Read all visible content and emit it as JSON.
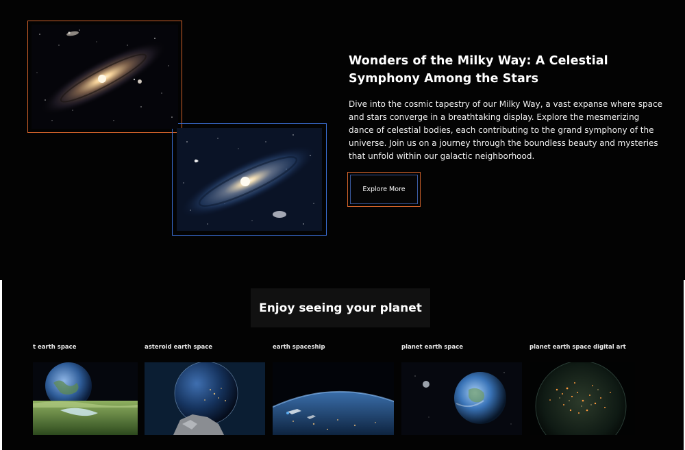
{
  "hero": {
    "title": "Wonders of the Milky Way: A Celestial Symphony Among the Stars",
    "text": "Dive into the cosmic tapestry of our Milky Way, a vast expanse where space and stars converge in a breathtaking display. Explore the mesmerizing dance of celestial bodies, each contributing to the grand symphony of the universe. Join us on a journey through the boundless beauty and mysteries that unfold within our galactic neighborhood.",
    "button_label": "Explore More"
  },
  "gallery": {
    "heading": "Enjoy seeing your planet",
    "items": [
      {
        "label": "t earth space"
      },
      {
        "label": "asteroid earth space"
      },
      {
        "label": "earth spaceship"
      },
      {
        "label": "planet earth space"
      },
      {
        "label": "planet earth space digital art"
      }
    ]
  },
  "colors": {
    "background": "#030303",
    "accent_orange": "#d1622a",
    "accent_blue": "#3a6fd6"
  }
}
